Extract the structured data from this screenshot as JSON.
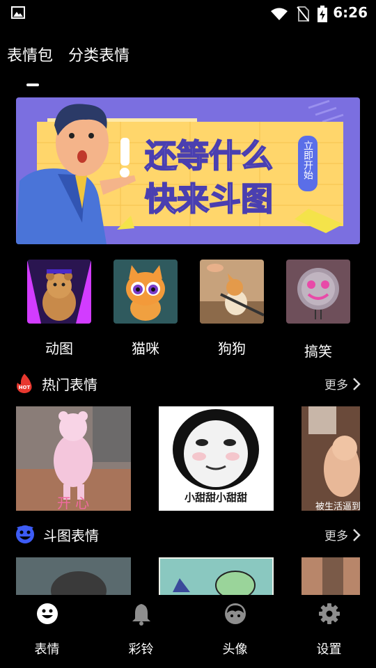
{
  "status_bar": {
    "time": "6:26"
  },
  "tabs": [
    {
      "label": "表情包"
    },
    {
      "label": "分类表情"
    }
  ],
  "banner": {
    "line1": "还等什么",
    "line2": "快来斗图",
    "badge": "立即开始"
  },
  "categories": [
    {
      "label": "动图"
    },
    {
      "label": "猫咪"
    },
    {
      "label": "狗狗"
    },
    {
      "label": "搞笑"
    }
  ],
  "sections": {
    "hot": {
      "title": "热门表情",
      "badge": "HOT",
      "more": "更多"
    },
    "battle": {
      "title": "斗图表情",
      "more": "更多"
    }
  },
  "hot_cards": [
    {
      "caption": "开  心"
    },
    {
      "caption": "小甜甜小甜甜"
    },
    {
      "caption": "被生活逼到"
    }
  ],
  "bottom_nav": [
    {
      "label": "表情"
    },
    {
      "label": "彩铃"
    },
    {
      "label": "头像"
    },
    {
      "label": "设置"
    }
  ],
  "colors": {
    "background": "#000000",
    "banner_purple": "#7b6fe0",
    "banner_yellow": "#ffd66b",
    "hot_red": "#e8382f",
    "battle_blue": "#3d5cf5"
  }
}
